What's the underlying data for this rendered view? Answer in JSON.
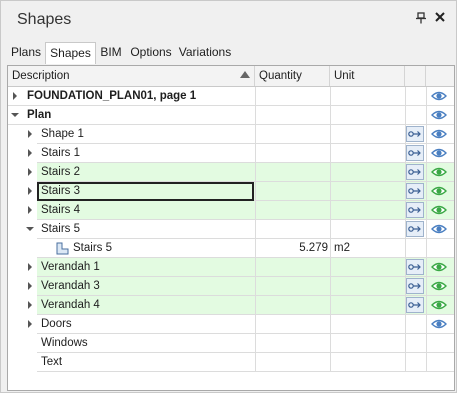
{
  "window": {
    "title": "Shapes",
    "pin_icon": "pin-icon",
    "close_icon": "close-icon"
  },
  "tabs": [
    {
      "label": "Plans",
      "active": false
    },
    {
      "label": "Shapes",
      "active": true
    },
    {
      "label": "BIM",
      "active": false
    },
    {
      "label": "Options",
      "active": false
    },
    {
      "label": "Variations",
      "active": false
    }
  ],
  "columns": {
    "description": "Description",
    "quantity": "Quantity",
    "unit": "Unit"
  },
  "colors": {
    "highlight_row": "#e3fbe1",
    "eye_green": "#3aa845",
    "eye_blue": "#4a7fc1",
    "focus_border": "#222222"
  },
  "rows": [
    {
      "label": "FOUNDATION_PLAN01, page 1",
      "level": 0,
      "expander": "closed",
      "bold": true,
      "highlight": false,
      "link": false,
      "eye": "blue",
      "quantity": "",
      "unit": ""
    },
    {
      "label": "Plan",
      "level": 0,
      "expander": "open",
      "bold": true,
      "highlight": false,
      "link": false,
      "eye": "blue",
      "quantity": "",
      "unit": ""
    },
    {
      "label": "Shape 1",
      "level": 1,
      "expander": "closed",
      "bold": false,
      "highlight": false,
      "link": true,
      "eye": "blue",
      "quantity": "",
      "unit": ""
    },
    {
      "label": "Stairs 1",
      "level": 1,
      "expander": "closed",
      "bold": false,
      "highlight": false,
      "link": true,
      "eye": "blue",
      "quantity": "",
      "unit": ""
    },
    {
      "label": "Stairs 2",
      "level": 1,
      "expander": "closed",
      "bold": false,
      "highlight": true,
      "link": true,
      "eye": "green",
      "quantity": "",
      "unit": ""
    },
    {
      "label": "Stairs 3",
      "level": 1,
      "expander": "closed",
      "bold": false,
      "highlight": true,
      "link": true,
      "eye": "green",
      "quantity": "",
      "unit": "",
      "focused": true
    },
    {
      "label": "Stairs 4",
      "level": 1,
      "expander": "closed",
      "bold": false,
      "highlight": true,
      "link": true,
      "eye": "green",
      "quantity": "",
      "unit": ""
    },
    {
      "label": "Stairs 5",
      "level": 1,
      "expander": "open",
      "bold": false,
      "highlight": false,
      "link": true,
      "eye": "blue",
      "quantity": "",
      "unit": ""
    },
    {
      "label": "Stairs 5",
      "level": 2,
      "expander": "none",
      "bold": false,
      "highlight": false,
      "link": false,
      "eye": "none",
      "quantity": "5.279",
      "unit": "m2",
      "shape_icon": "area-shape-icon"
    },
    {
      "label": "Verandah 1",
      "level": 1,
      "expander": "closed",
      "bold": false,
      "highlight": true,
      "link": true,
      "eye": "green",
      "quantity": "",
      "unit": ""
    },
    {
      "label": "Verandah 3",
      "level": 1,
      "expander": "closed",
      "bold": false,
      "highlight": true,
      "link": true,
      "eye": "green",
      "quantity": "",
      "unit": ""
    },
    {
      "label": "Verandah 4",
      "level": 1,
      "expander": "closed",
      "bold": false,
      "highlight": true,
      "link": true,
      "eye": "green",
      "quantity": "",
      "unit": ""
    },
    {
      "label": "Doors",
      "level": 1,
      "expander": "closed",
      "bold": false,
      "highlight": false,
      "link": false,
      "eye": "blue",
      "quantity": "",
      "unit": ""
    },
    {
      "label": "Windows",
      "level": 1,
      "expander": "none",
      "bold": false,
      "highlight": false,
      "link": false,
      "eye": "none",
      "quantity": "",
      "unit": ""
    },
    {
      "label": "Text",
      "level": 1,
      "expander": "none",
      "bold": false,
      "highlight": false,
      "link": false,
      "eye": "none",
      "quantity": "",
      "unit": ""
    }
  ]
}
